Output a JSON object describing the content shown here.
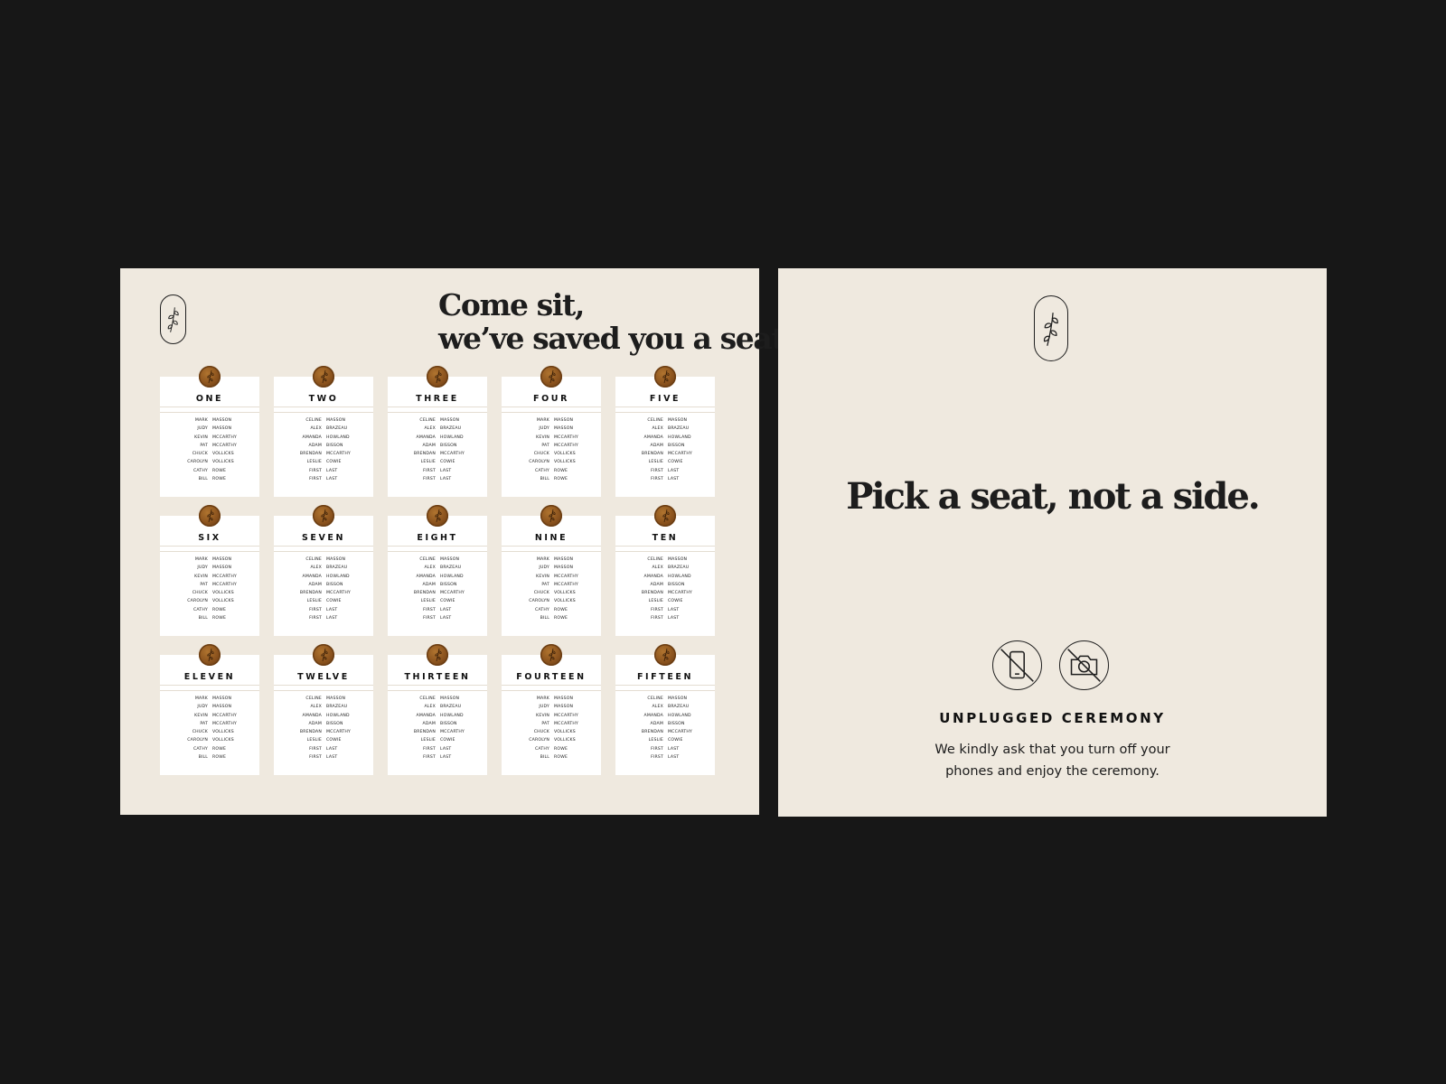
{
  "seating_chart": {
    "headline_lines": [
      "Come sit,",
      "we’ve saved you a seat."
    ],
    "icons": {
      "badge": "sprig-icon",
      "seal": "wax-seal-icon"
    },
    "colors": {
      "board": "#efe9df",
      "card": "#ffffff",
      "seal": "#8a521d",
      "background": "#171717"
    },
    "tables": [
      {
        "name": "ONE",
        "guests": [
          [
            "MARK",
            "MASSON"
          ],
          [
            "JUDY",
            "MASSON"
          ],
          [
            "KEVIN",
            "MCCARTHY"
          ],
          [
            "PAT",
            "MCCARTHY"
          ],
          [
            "CHUCK",
            "VOLLICKS"
          ],
          [
            "CAROLYN",
            "VOLLICKS"
          ],
          [
            "CATHY",
            "ROWE"
          ],
          [
            "BILL",
            "ROWE"
          ]
        ]
      },
      {
        "name": "TWO",
        "guests": [
          [
            "CELINE",
            "MASSON"
          ],
          [
            "ALEX",
            "BRAZEAU"
          ],
          [
            "AMANDA",
            "HOWLAND"
          ],
          [
            "ADAM",
            "BISSON"
          ],
          [
            "BRENDAN",
            "MCCARTHY"
          ],
          [
            "LESLIE",
            "COWIE"
          ],
          [
            "FIRST",
            "LAST"
          ],
          [
            "FIRST",
            "LAST"
          ]
        ]
      },
      {
        "name": "THREE",
        "guests": [
          [
            "CELINE",
            "MASSON"
          ],
          [
            "ALEX",
            "BRAZEAU"
          ],
          [
            "AMANDA",
            "HOWLAND"
          ],
          [
            "ADAM",
            "BISSON"
          ],
          [
            "BRENDAN",
            "MCCARTHY"
          ],
          [
            "LESLIE",
            "COWIE"
          ],
          [
            "FIRST",
            "LAST"
          ],
          [
            "FIRST",
            "LAST"
          ]
        ]
      },
      {
        "name": "FOUR",
        "guests": [
          [
            "MARK",
            "MASSON"
          ],
          [
            "JUDY",
            "MASSON"
          ],
          [
            "KEVIN",
            "MCCARTHY"
          ],
          [
            "PAT",
            "MCCARTHY"
          ],
          [
            "CHUCK",
            "VOLLICKS"
          ],
          [
            "CAROLYN",
            "VOLLICKS"
          ],
          [
            "CATHY",
            "ROWE"
          ],
          [
            "BILL",
            "ROWE"
          ]
        ]
      },
      {
        "name": "FIVE",
        "guests": [
          [
            "CELINE",
            "MASSON"
          ],
          [
            "ALEX",
            "BRAZEAU"
          ],
          [
            "AMANDA",
            "HOWLAND"
          ],
          [
            "ADAM",
            "BISSON"
          ],
          [
            "BRENDAN",
            "MCCARTHY"
          ],
          [
            "LESLIE",
            "COWIE"
          ],
          [
            "FIRST",
            "LAST"
          ],
          [
            "FIRST",
            "LAST"
          ]
        ]
      },
      {
        "name": "SIX",
        "guests": [
          [
            "MARK",
            "MASSON"
          ],
          [
            "JUDY",
            "MASSON"
          ],
          [
            "KEVIN",
            "MCCARTHY"
          ],
          [
            "PAT",
            "MCCARTHY"
          ],
          [
            "CHUCK",
            "VOLLICKS"
          ],
          [
            "CAROLYN",
            "VOLLICKS"
          ],
          [
            "CATHY",
            "ROWE"
          ],
          [
            "BILL",
            "ROWE"
          ]
        ]
      },
      {
        "name": "SEVEN",
        "guests": [
          [
            "CELINE",
            "MASSON"
          ],
          [
            "ALEX",
            "BRAZEAU"
          ],
          [
            "AMANDA",
            "HOWLAND"
          ],
          [
            "ADAM",
            "BISSON"
          ],
          [
            "BRENDAN",
            "MCCARTHY"
          ],
          [
            "LESLIE",
            "COWIE"
          ],
          [
            "FIRST",
            "LAST"
          ],
          [
            "FIRST",
            "LAST"
          ]
        ]
      },
      {
        "name": "EIGHT",
        "guests": [
          [
            "CELINE",
            "MASSON"
          ],
          [
            "ALEX",
            "BRAZEAU"
          ],
          [
            "AMANDA",
            "HOWLAND"
          ],
          [
            "ADAM",
            "BISSON"
          ],
          [
            "BRENDAN",
            "MCCARTHY"
          ],
          [
            "LESLIE",
            "COWIE"
          ],
          [
            "FIRST",
            "LAST"
          ],
          [
            "FIRST",
            "LAST"
          ]
        ]
      },
      {
        "name": "NINE",
        "guests": [
          [
            "MARK",
            "MASSON"
          ],
          [
            "JUDY",
            "MASSON"
          ],
          [
            "KEVIN",
            "MCCARTHY"
          ],
          [
            "PAT",
            "MCCARTHY"
          ],
          [
            "CHUCK",
            "VOLLICKS"
          ],
          [
            "CAROLYN",
            "VOLLICKS"
          ],
          [
            "CATHY",
            "ROWE"
          ],
          [
            "BILL",
            "ROWE"
          ]
        ]
      },
      {
        "name": "TEN",
        "guests": [
          [
            "CELINE",
            "MASSON"
          ],
          [
            "ALEX",
            "BRAZEAU"
          ],
          [
            "AMANDA",
            "HOWLAND"
          ],
          [
            "ADAM",
            "BISSON"
          ],
          [
            "BRENDAN",
            "MCCARTHY"
          ],
          [
            "LESLIE",
            "COWIE"
          ],
          [
            "FIRST",
            "LAST"
          ],
          [
            "FIRST",
            "LAST"
          ]
        ]
      },
      {
        "name": "ELEVEN",
        "guests": [
          [
            "MARK",
            "MASSON"
          ],
          [
            "JUDY",
            "MASSON"
          ],
          [
            "KEVIN",
            "MCCARTHY"
          ],
          [
            "PAT",
            "MCCARTHY"
          ],
          [
            "CHUCK",
            "VOLLICKS"
          ],
          [
            "CAROLYN",
            "VOLLICKS"
          ],
          [
            "CATHY",
            "ROWE"
          ],
          [
            "BILL",
            "ROWE"
          ]
        ]
      },
      {
        "name": "TWELVE",
        "guests": [
          [
            "CELINE",
            "MASSON"
          ],
          [
            "ALEX",
            "BRAZEAU"
          ],
          [
            "AMANDA",
            "HOWLAND"
          ],
          [
            "ADAM",
            "BISSON"
          ],
          [
            "BRENDAN",
            "MCCARTHY"
          ],
          [
            "LESLIE",
            "COWIE"
          ],
          [
            "FIRST",
            "LAST"
          ],
          [
            "FIRST",
            "LAST"
          ]
        ]
      },
      {
        "name": "THIRTEEN",
        "guests": [
          [
            "CELINE",
            "MASSON"
          ],
          [
            "ALEX",
            "BRAZEAU"
          ],
          [
            "AMANDA",
            "HOWLAND"
          ],
          [
            "ADAM",
            "BISSON"
          ],
          [
            "BRENDAN",
            "MCCARTHY"
          ],
          [
            "LESLIE",
            "COWIE"
          ],
          [
            "FIRST",
            "LAST"
          ],
          [
            "FIRST",
            "LAST"
          ]
        ]
      },
      {
        "name": "FOURTEEN",
        "guests": [
          [
            "MARK",
            "MASSON"
          ],
          [
            "JUDY",
            "MASSON"
          ],
          [
            "KEVIN",
            "MCCARTHY"
          ],
          [
            "PAT",
            "MCCARTHY"
          ],
          [
            "CHUCK",
            "VOLLICKS"
          ],
          [
            "CAROLYN",
            "VOLLICKS"
          ],
          [
            "CATHY",
            "ROWE"
          ],
          [
            "BILL",
            "ROWE"
          ]
        ]
      },
      {
        "name": "FIFTEEN",
        "guests": [
          [
            "CELINE",
            "MASSON"
          ],
          [
            "ALEX",
            "BRAZEAU"
          ],
          [
            "AMANDA",
            "HOWLAND"
          ],
          [
            "ADAM",
            "BISSON"
          ],
          [
            "BRENDAN",
            "MCCARTHY"
          ],
          [
            "LESLIE",
            "COWIE"
          ],
          [
            "FIRST",
            "LAST"
          ],
          [
            "FIRST",
            "LAST"
          ]
        ]
      }
    ]
  },
  "unplugged_sign": {
    "tagline": "Pick a seat, not a side.",
    "icons": [
      "sprig-icon",
      "no-phone-icon",
      "no-camera-icon"
    ],
    "title": "UNPLUGGED CEREMONY",
    "message_lines": [
      "We kindly ask that you turn off your",
      "phones and enjoy the ceremony."
    ]
  }
}
